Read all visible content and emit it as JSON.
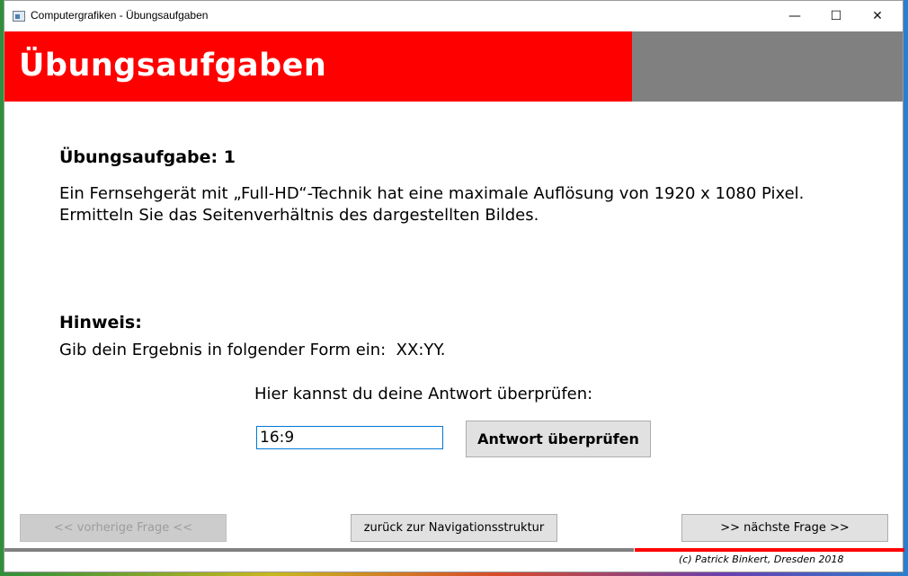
{
  "window": {
    "title": "Computergrafiken - Übungsaufgaben",
    "controls": {
      "minimize": "—",
      "maximize": "☐",
      "close": "✕"
    }
  },
  "header": {
    "title": "Übungsaufgaben",
    "colors": {
      "accent": "#ff0000",
      "secondary": "#808080"
    }
  },
  "question": {
    "title": "Übungsaufgabe: 1",
    "text": "Ein Fernsehgerät mit „Full-HD“-Technik hat eine maximale Auflösung von 1920 x 1080 Pixel. Ermitteln Sie das Seitenverhältnis des dargestellten Bildes."
  },
  "hint": {
    "title": "Hinweis:",
    "text": "Gib dein Ergebnis in folgender Form ein:  XX:YY."
  },
  "answer": {
    "prompt": "Hier kannst du deine Antwort überprüfen:",
    "value": "16:9",
    "check_label": "Antwort überprüfen"
  },
  "navigation": {
    "prev_label": "<< vorherige Frage <<",
    "home_label": "zurück zur Navigationsstruktur",
    "next_label": ">> nächste Frage >>"
  },
  "footer": {
    "copyright": "(c) Patrick Binkert, Dresden 2018"
  }
}
